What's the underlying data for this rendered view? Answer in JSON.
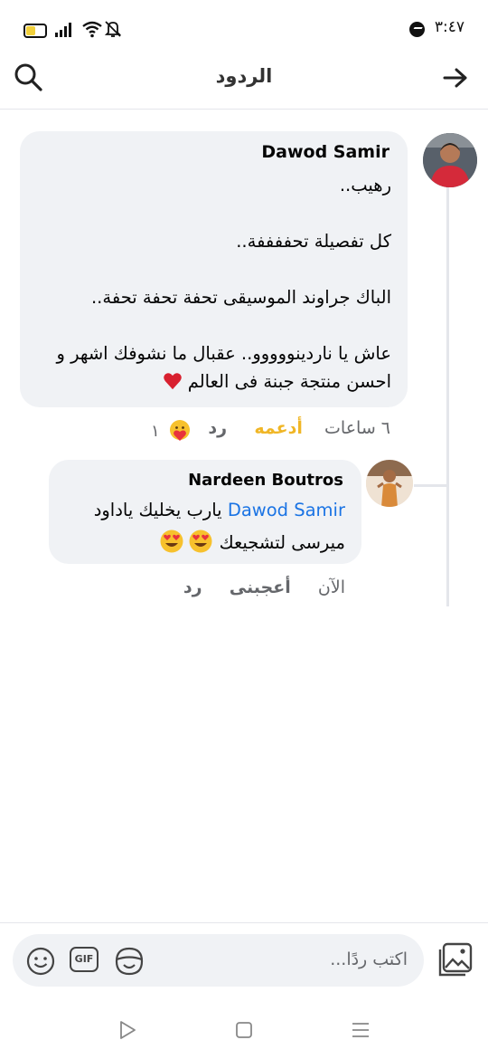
{
  "status_bar": {
    "time": "٣:٤٧"
  },
  "header": {
    "title": "الردود"
  },
  "comment": {
    "author": "Dawod Samir",
    "lines": [
      "رهيب..",
      "كل تفصيلة تحففففة..",
      "الباك جراوند الموسيقى تحفة تحفة تحفة..",
      "عاش يا ناردينووووو..  عقبال ما نشوفك اشهر و",
      "احسن منتجة جبنة فى العالم"
    ],
    "time": "٦ ساعات",
    "reaction_label": "أدعمه",
    "reply_label": "رد",
    "reaction_count": "١"
  },
  "reply": {
    "author": "Nardeen Boutros",
    "mention": "Dawod Samir",
    "line1": "يارب يخليك ياداود",
    "line2": "ميرسى لتشجيعك",
    "time": "الآن",
    "like_label": "أعجبنى",
    "reply_label": "رد"
  },
  "composer": {
    "placeholder": "اكتب ردًا...",
    "gif_label": "GIF"
  }
}
